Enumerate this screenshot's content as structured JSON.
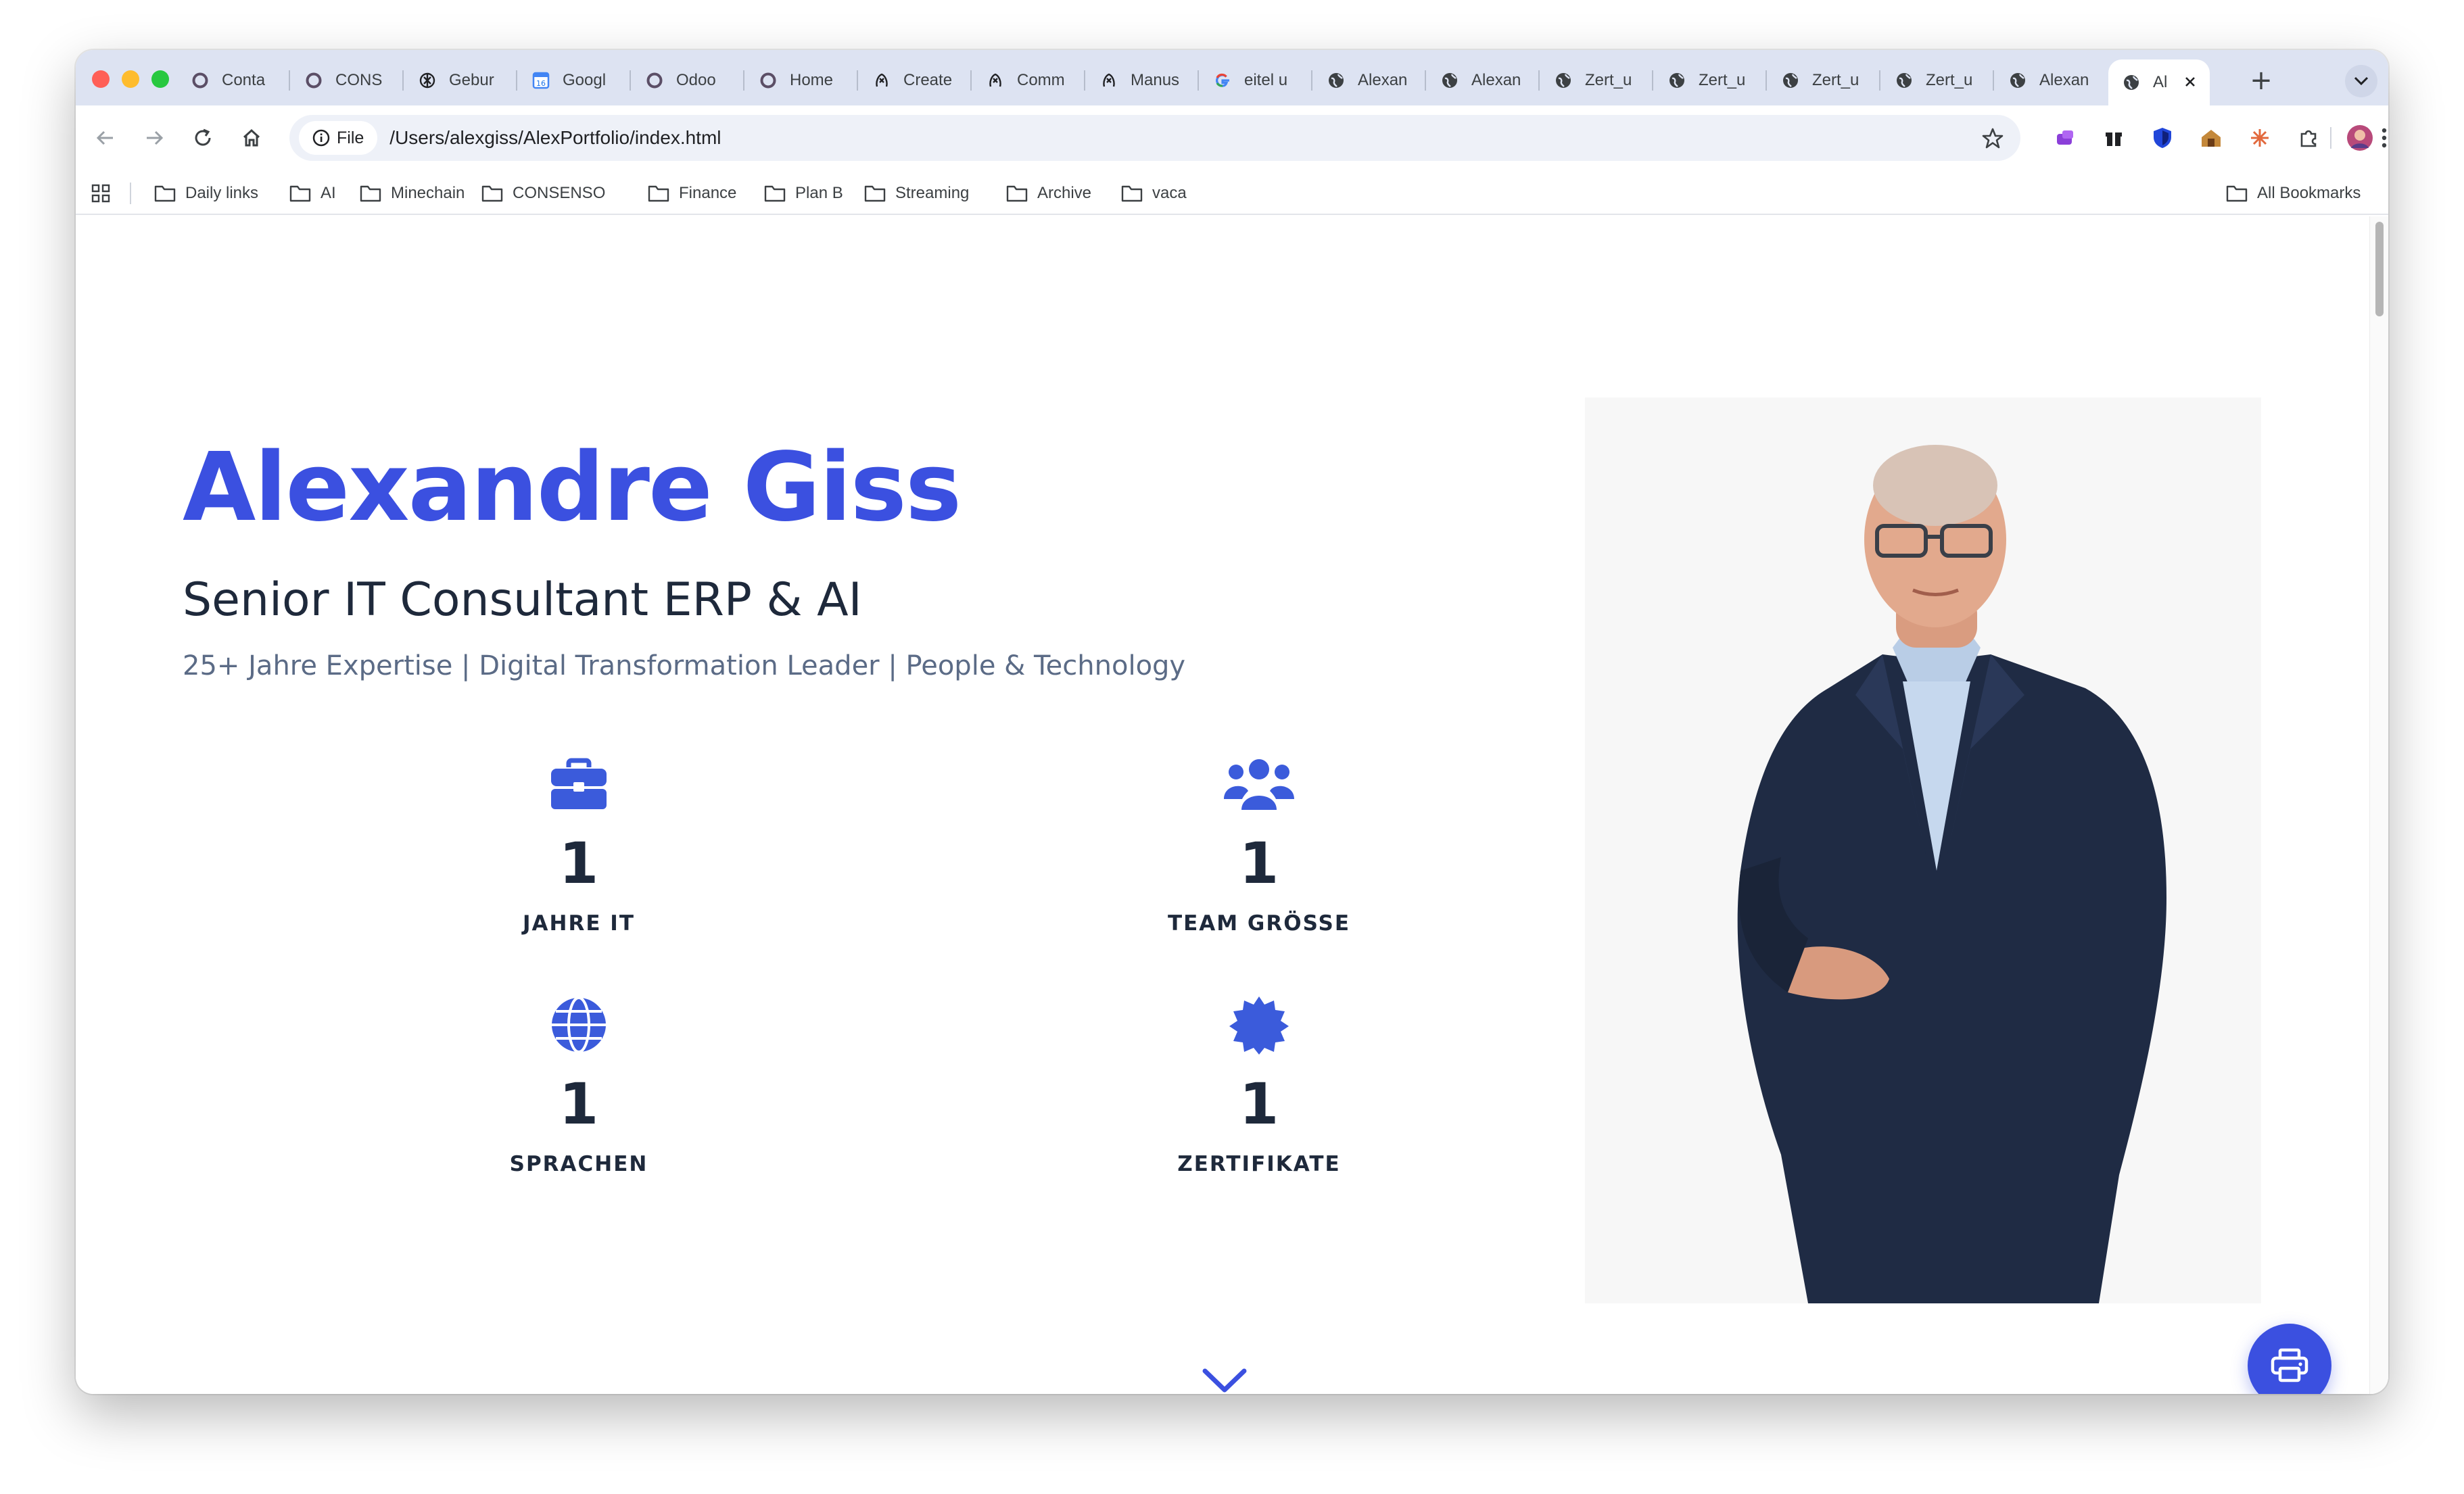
{
  "browser": {
    "traffic_lights": {
      "close": "#ff5f57",
      "minimize": "#febc2e",
      "maximize": "#28c840"
    },
    "tabs": [
      {
        "label": "Conta",
        "icon": "odoo-icon"
      },
      {
        "label": "CONS",
        "icon": "odoo-icon"
      },
      {
        "label": "Gebur",
        "icon": "openai-icon"
      },
      {
        "label": "Googl",
        "icon": "google-calendar-icon"
      },
      {
        "label": "Odoo",
        "icon": "odoo-icon"
      },
      {
        "label": "Home",
        "icon": "odoo-icon"
      },
      {
        "label": "Create",
        "icon": "manus-icon"
      },
      {
        "label": "Comm",
        "icon": "manus-icon"
      },
      {
        "label": "Manus",
        "icon": "manus-icon"
      },
      {
        "label": "eitel u",
        "icon": "google-icon"
      },
      {
        "label": "Alexan",
        "icon": "globe-icon"
      },
      {
        "label": "Alexan",
        "icon": "globe-icon"
      },
      {
        "label": "Zert_u",
        "icon": "globe-icon"
      },
      {
        "label": "Zert_u",
        "icon": "globe-icon"
      },
      {
        "label": "Zert_u",
        "icon": "globe-icon"
      },
      {
        "label": "Zert_u",
        "icon": "globe-icon"
      },
      {
        "label": "Alexan",
        "icon": "globe-icon"
      },
      {
        "label": "Al",
        "icon": "globe-icon",
        "active": true
      }
    ],
    "new_tab_symbol": "+",
    "address": {
      "scheme_label": "File",
      "url": "/Users/alexgiss/AlexPortfolio/index.html"
    },
    "bookmarks": [
      "Daily links",
      "AI",
      "Minechain",
      "CONSENSO",
      "Finance",
      "Plan B",
      "Streaming",
      "Archive",
      "vaca"
    ],
    "all_bookmarks_label": "All Bookmarks"
  },
  "hero": {
    "name": "Alexandre Giss",
    "title": "Senior IT Consultant ERP & AI",
    "subtitle": "25+ Jahre Expertise | Digital Transformation Leader | People & Technology",
    "stats": [
      {
        "value": "1",
        "label": "JAHRE IT",
        "icon": "briefcase-icon"
      },
      {
        "value": "1",
        "label": "TEAM GRÖSSE",
        "icon": "users-icon"
      },
      {
        "value": "1",
        "label": "SPRACHEN",
        "icon": "globe-icon"
      },
      {
        "value": "1",
        "label": "ZERTIFIKATE",
        "icon": "certificate-icon"
      }
    ]
  },
  "colors": {
    "accent": "#3b50e0",
    "heading": "#1e293b",
    "muted": "#5b6b86"
  }
}
